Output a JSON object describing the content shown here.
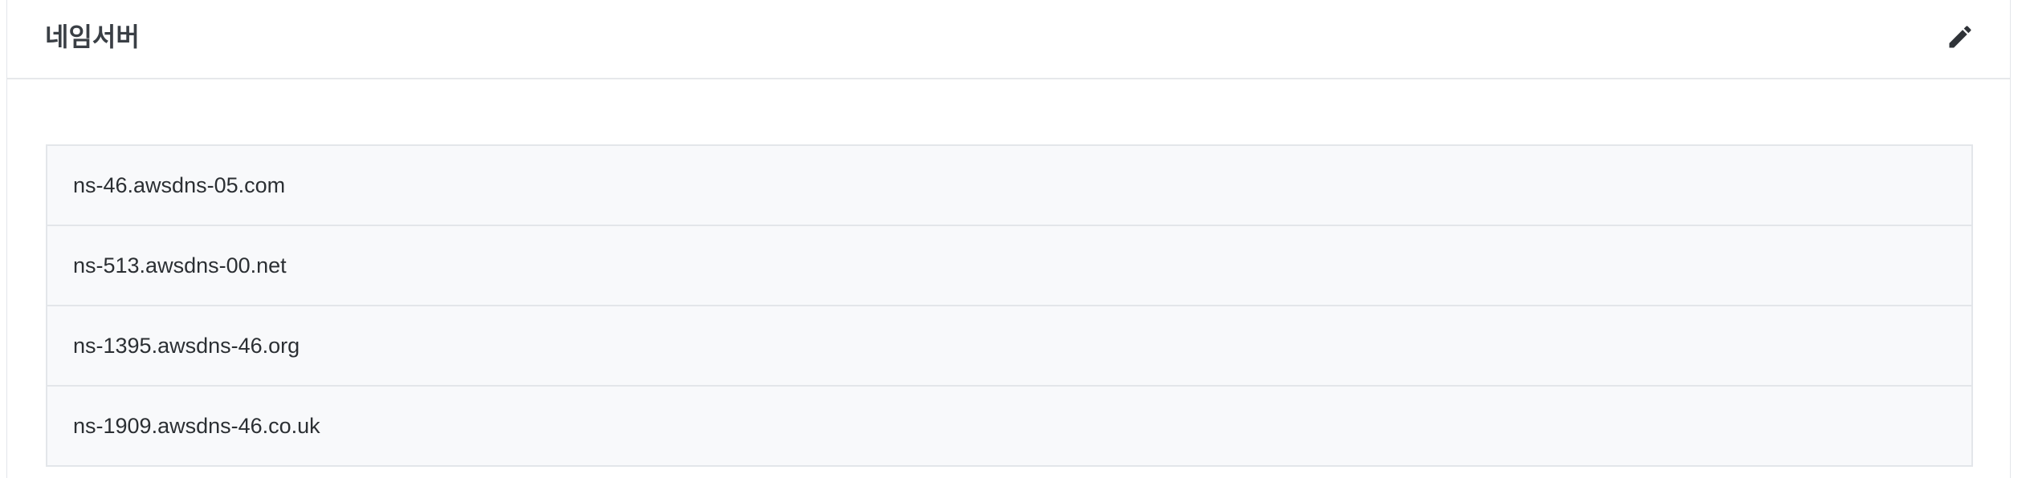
{
  "panel": {
    "title": "네임서버",
    "edit_icon": "pencil-icon"
  },
  "nameservers": [
    "ns-46.awsdns-05.com",
    "ns-513.awsdns-00.net",
    "ns-1395.awsdns-46.org",
    "ns-1909.awsdns-46.co.uk"
  ],
  "colors": {
    "border": "#e3e6ea",
    "list_background": "#f8f9fb",
    "text": "#2b2f33"
  }
}
